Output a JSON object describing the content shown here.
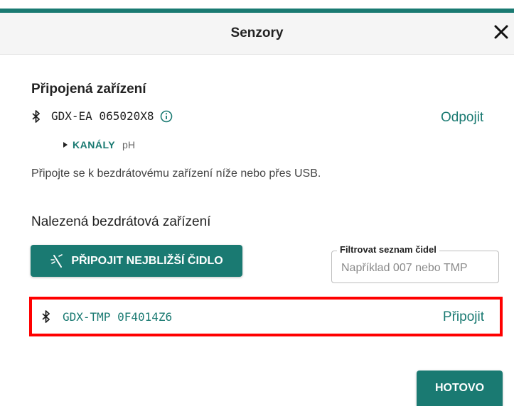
{
  "header": {
    "title": "Senzory",
    "close_label": "✕"
  },
  "connected": {
    "section_title": "Připojená zařízení",
    "device_name": "GDX-EA 065020X8",
    "disconnect_label": "Odpojit",
    "channels_label": "KANÁLY",
    "channels_value": "pH"
  },
  "hint": "Připojte se k bezdrátovému zařízení níže nebo přes USB.",
  "found": {
    "section_title": "Nalezená bezdrátová zařízení",
    "connect_nearest_label": "PŘIPOJIT NEJBLIŽŠÍ ČIDLO",
    "filter_legend": "Filtrovat seznam čidel",
    "filter_placeholder": "Například 007 nebo TMP",
    "filter_value": "",
    "devices": [
      {
        "name": "GDX-TMP 0F4014Z6",
        "connect_label": "Připojit"
      }
    ]
  },
  "footer": {
    "done_label": "HOTOVO"
  },
  "colors": {
    "accent": "#1a7a72",
    "highlight": "#ff0000"
  },
  "icons": {
    "bluetooth": "bluetooth-icon",
    "info": "info-icon",
    "close": "close-icon",
    "connect_nearest": "proximity-icon",
    "expand": "triangle-right-icon"
  }
}
